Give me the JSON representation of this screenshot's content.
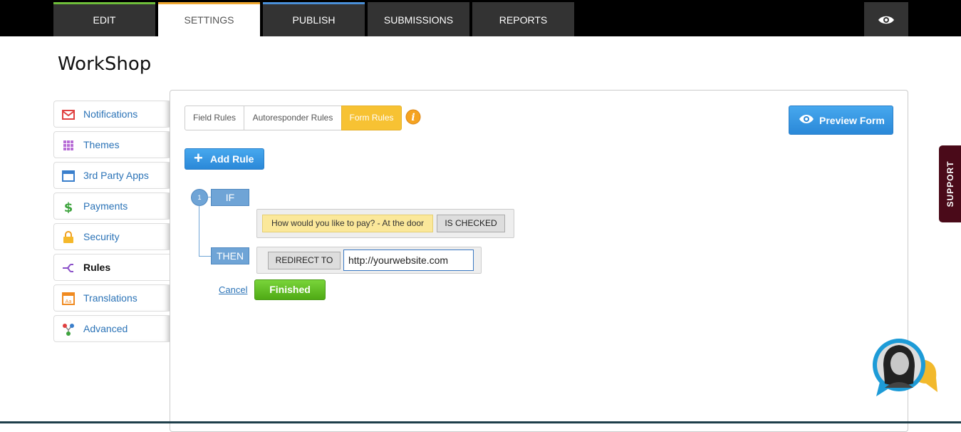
{
  "nav": {
    "tabs": [
      {
        "label": "EDIT",
        "stripe": "#6fbf3a"
      },
      {
        "label": "SETTINGS",
        "stripe": "#f0a830"
      },
      {
        "label": "PUBLISH",
        "stripe": "#4a90d9"
      },
      {
        "label": "SUBMISSIONS",
        "stripe": "#333333"
      },
      {
        "label": "REPORTS",
        "stripe": "#333333"
      }
    ],
    "preview_icon": "eye-icon"
  },
  "page_title": "WorkShop",
  "sidebar": {
    "items": [
      {
        "label": "Notifications",
        "icon": "envelope-icon"
      },
      {
        "label": "Themes",
        "icon": "grid-icon"
      },
      {
        "label": "3rd Party Apps",
        "icon": "window-icon"
      },
      {
        "label": "Payments",
        "icon": "dollar-icon"
      },
      {
        "label": "Security",
        "icon": "lock-icon"
      },
      {
        "label": "Rules",
        "icon": "branch-icon",
        "active": true
      },
      {
        "label": "Translations",
        "icon": "translate-icon"
      },
      {
        "label": "Advanced",
        "icon": "network-icon"
      }
    ]
  },
  "rules": {
    "tabs": [
      "Field Rules",
      "Autoresponder Rules",
      "Form Rules"
    ],
    "active_tab": "Form Rules",
    "add_rule_label": "Add Rule",
    "preview_label": "Preview Form",
    "rule_number": "1",
    "if_label": "IF",
    "then_label": "THEN",
    "condition_field": "How would you like to pay? - At the door",
    "condition_operator": "IS CHECKED",
    "action_label": "REDIRECT TO",
    "action_value": "http://yourwebsite.com",
    "cancel_label": "Cancel",
    "finished_label": "Finished"
  },
  "support_label": "SUPPORT",
  "colors": {
    "accent_blue": "#2a88d8",
    "accent_green": "#4faa15",
    "active_tab_yellow": "#f7c233",
    "support_bg": "#4a0a19"
  }
}
